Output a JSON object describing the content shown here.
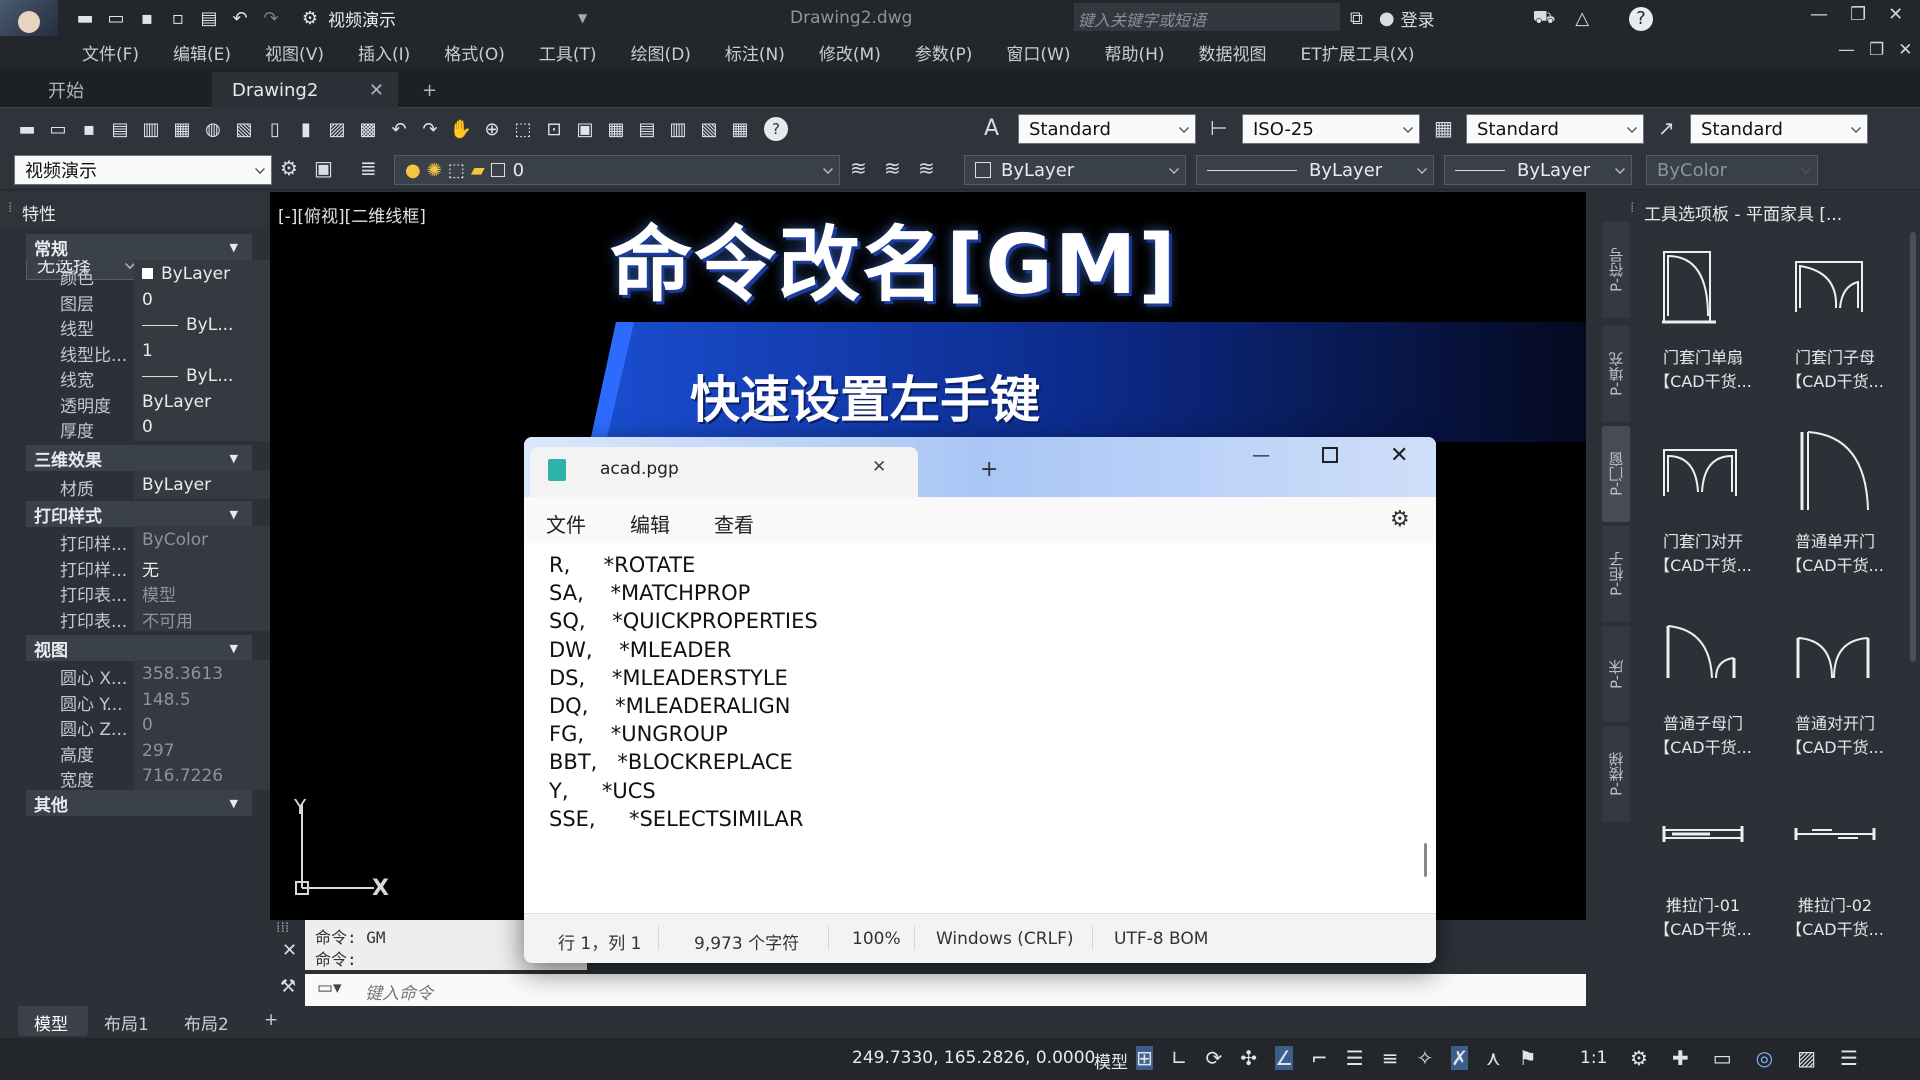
{
  "app": {
    "title": "Drawing2.dwg",
    "workspace": "视频演示",
    "search_placeholder": "键入关键字或短语",
    "login_label": "登录"
  },
  "menu": [
    "文件(F)",
    "编辑(E)",
    "视图(V)",
    "插入(I)",
    "格式(O)",
    "工具(T)",
    "绘图(D)",
    "标注(N)",
    "修改(M)",
    "参数(P)",
    "窗口(W)",
    "帮助(H)",
    "数据视图",
    "ET扩展工具(X)"
  ],
  "doc_tabs": {
    "start": "开始",
    "active": "Drawing2",
    "new": "+"
  },
  "styles": {
    "text_style": "Standard",
    "dim_style": "ISO-25",
    "table_style": "Standard",
    "mleader_style": "Standard"
  },
  "layer_bar": {
    "workspace": "视频演示",
    "layer": "0",
    "color": "ByLayer",
    "linetype": "ByLayer",
    "lineweight": "ByLayer",
    "plotstyle": "ByColor"
  },
  "properties": {
    "title": "特性",
    "selection": "无选择",
    "sections": {
      "general": "常规",
      "three_d": "三维效果",
      "plot": "打印样式",
      "view": "视图",
      "misc": "其他"
    },
    "general": [
      {
        "k": "颜色",
        "v": "ByLayer"
      },
      {
        "k": "图层",
        "v": "0"
      },
      {
        "k": "线型",
        "v": "ByL..."
      },
      {
        "k": "线型比...",
        "v": "1"
      },
      {
        "k": "线宽",
        "v": "ByL..."
      },
      {
        "k": "透明度",
        "v": "ByLayer"
      },
      {
        "k": "厚度",
        "v": "0"
      }
    ],
    "three_d": [
      {
        "k": "材质",
        "v": "ByLayer"
      }
    ],
    "plot": [
      {
        "k": "打印样...",
        "v": "ByColor"
      },
      {
        "k": "打印样...",
        "v": "无"
      },
      {
        "k": "打印表...",
        "v": "模型"
      },
      {
        "k": "打印表...",
        "v": "不可用"
      }
    ],
    "view": [
      {
        "k": "圆心 X...",
        "v": "358.3613"
      },
      {
        "k": "圆心 Y...",
        "v": "148.5"
      },
      {
        "k": "圆心 Z...",
        "v": "0"
      },
      {
        "k": "高度",
        "v": "297"
      },
      {
        "k": "宽度",
        "v": "716.7226"
      }
    ]
  },
  "viewport": {
    "label": "[-][俯视][二维线框]",
    "headline": "命令改名[GM]",
    "subtitle": "快速设置左手键",
    "ucs_y": "Y",
    "ucs_x": "X"
  },
  "command": {
    "history": [
      "命令: GM",
      "命令:"
    ],
    "placeholder": "键入命令"
  },
  "tool_palette": {
    "title": "工具选项板 - 平面家具 [...",
    "tabs": [
      "P-符号",
      "P-填充",
      "P-门窗",
      "P-柜子",
      "P-床",
      "P-楼梯"
    ],
    "items": [
      {
        "l1": "门套门单扇",
        "l2": "【CAD干货..."
      },
      {
        "l1": "门套门子母",
        "l2": "【CAD干货..."
      },
      {
        "l1": "门套门对开",
        "l2": "【CAD干货..."
      },
      {
        "l1": "普通单开门",
        "l2": "【CAD干货..."
      },
      {
        "l1": "普通子母门",
        "l2": "【CAD干货..."
      },
      {
        "l1": "普通对开门",
        "l2": "【CAD干货..."
      },
      {
        "l1": "推拉门-01",
        "l2": "【CAD干货..."
      },
      {
        "l1": "推拉门-02",
        "l2": "【CAD干货..."
      }
    ]
  },
  "layouts": [
    "模型",
    "布局1",
    "布局2",
    "+"
  ],
  "status": {
    "coords": "249.7330, 165.2826, 0.0000",
    "model": "模型",
    "scale": "1:1"
  },
  "notepad": {
    "tab_title": "acad.pgp",
    "menu": [
      "文件",
      "编辑",
      "查看"
    ],
    "lines": [
      "R,     *ROTATE",
      "SA,    *MATCHPROP",
      "SQ,    *QUICKPROPERTIES",
      "DW,    *MLEADER",
      "DS,    *MLEADERSTYLE",
      "DQ,    *MLEADERALIGN",
      "FG,    *UNGROUP",
      "BBT,   *BLOCKREPLACE",
      "Y,     *UCS",
      "SSE,     *SELECTSIMILAR"
    ],
    "status": {
      "position": "行 1，列 1",
      "chars": "9,973 个字符",
      "zoom": "100%",
      "eol": "Windows (CRLF)",
      "encoding": "UTF-8 BOM"
    }
  }
}
